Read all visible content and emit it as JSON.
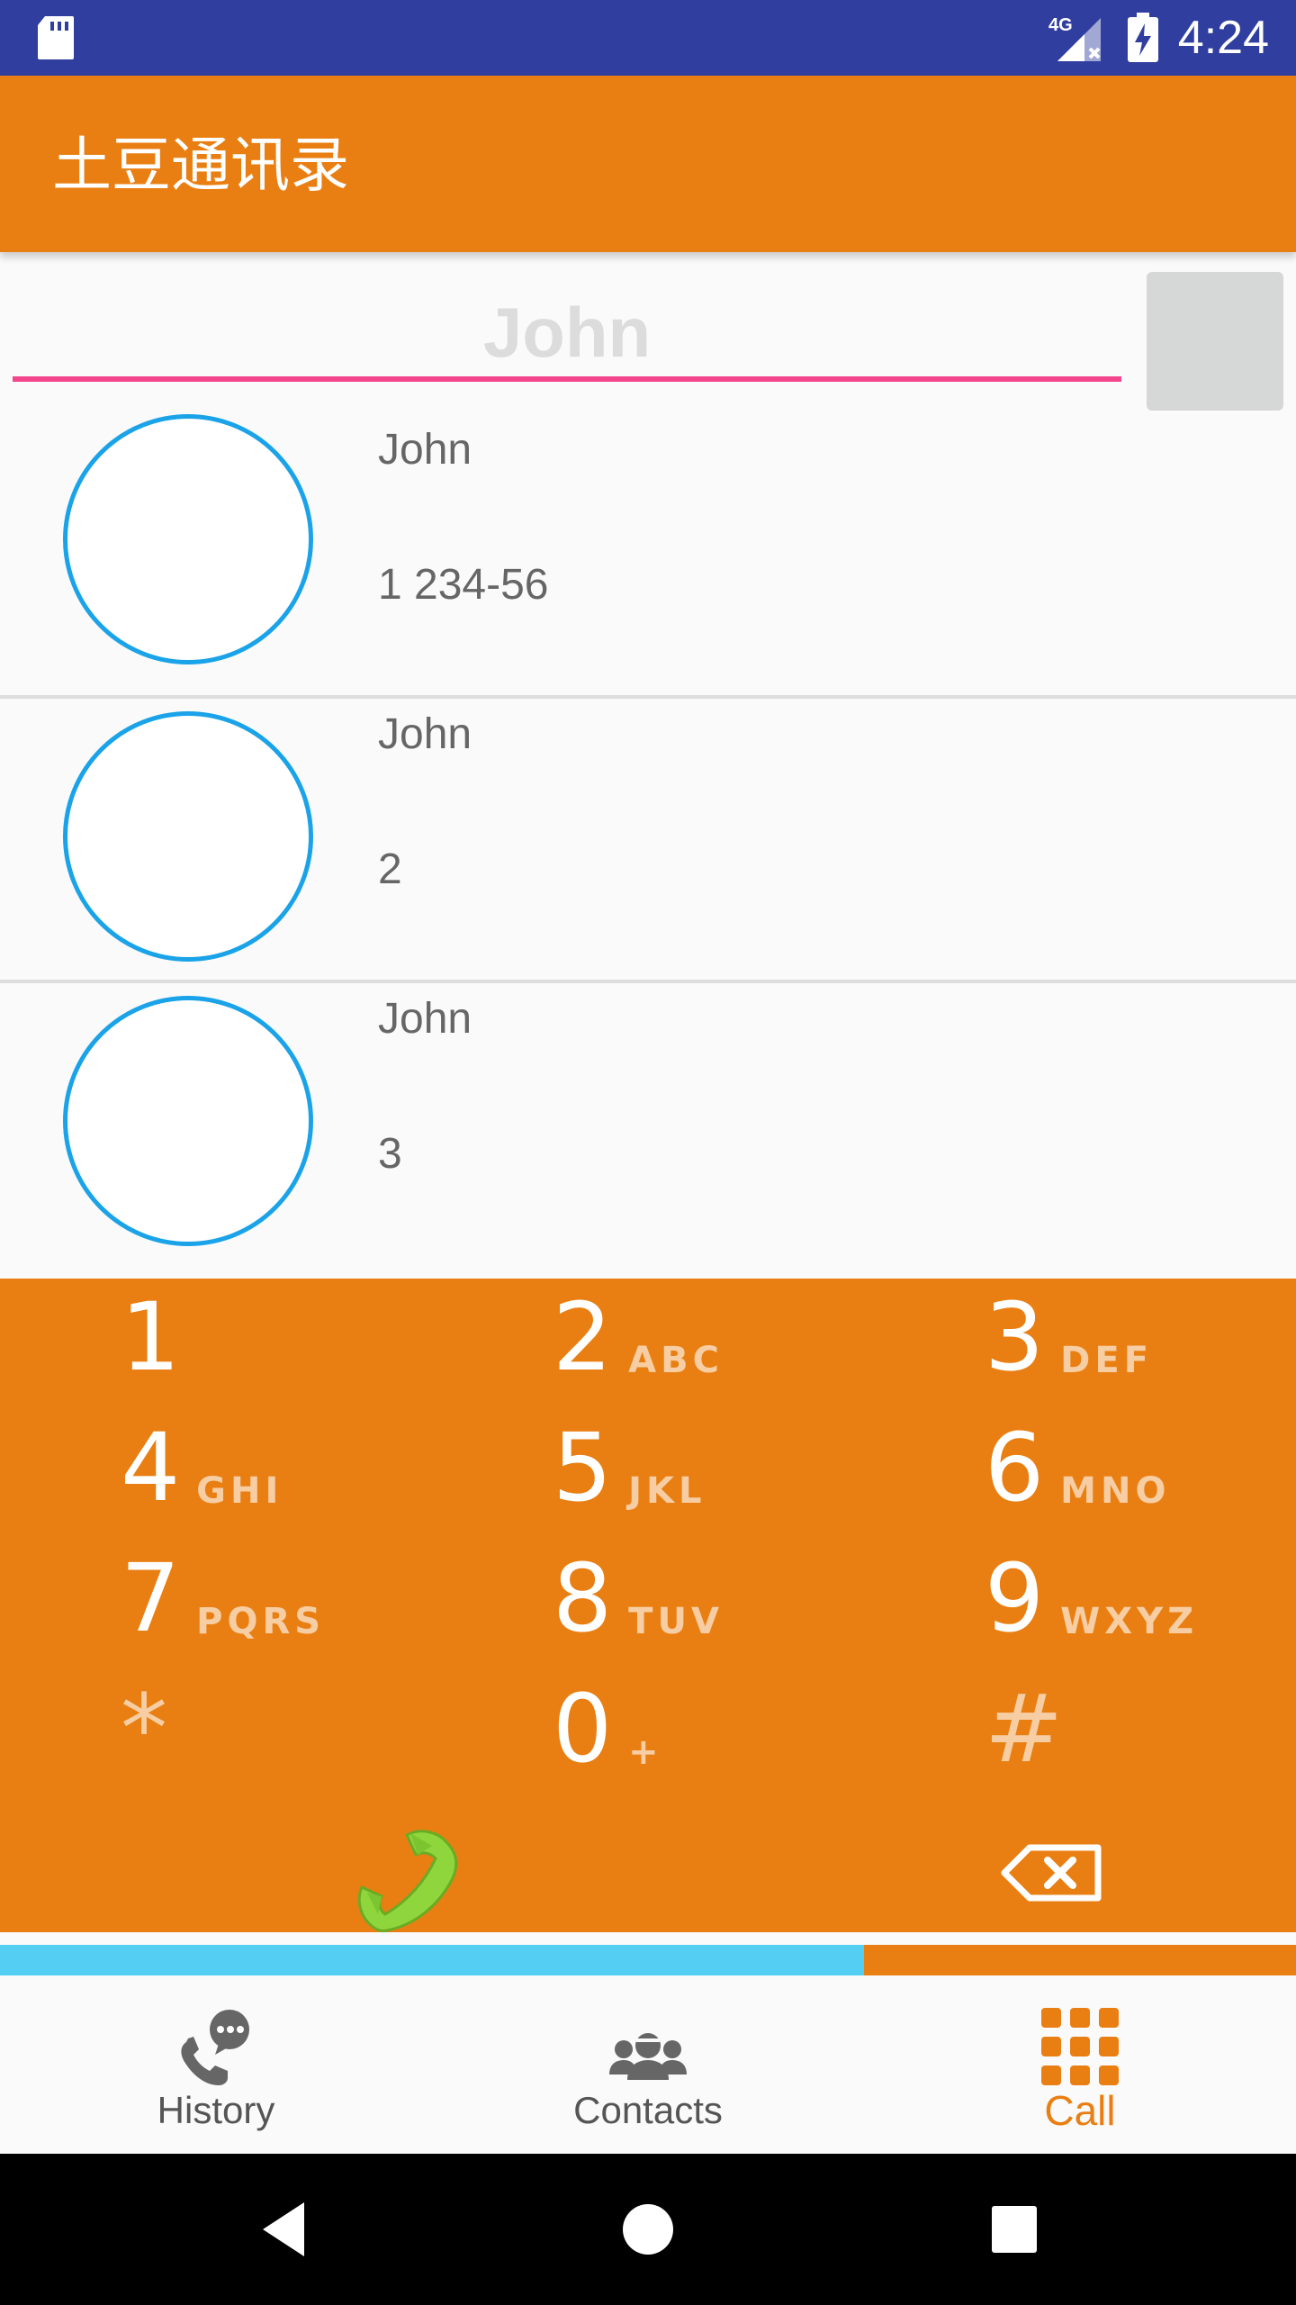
{
  "status_bar": {
    "time": "4:24",
    "network_label": "4G",
    "icons": [
      "sd-card-icon",
      "signal-icon",
      "battery-charging-icon"
    ]
  },
  "app_bar": {
    "title": "土豆通讯录"
  },
  "search": {
    "placeholder": "John",
    "value": ""
  },
  "contacts": [
    {
      "name": "John",
      "number": "1 234-56"
    },
    {
      "name": "John",
      "number": "2"
    },
    {
      "name": "John",
      "number": "3"
    }
  ],
  "dialpad": {
    "keys": [
      {
        "digit": "1",
        "letters": ""
      },
      {
        "digit": "2",
        "letters": "ABC"
      },
      {
        "digit": "3",
        "letters": "DEF"
      },
      {
        "digit": "4",
        "letters": "GHI"
      },
      {
        "digit": "5",
        "letters": "JKL"
      },
      {
        "digit": "6",
        "letters": "MNO"
      },
      {
        "digit": "7",
        "letters": "PQRS"
      },
      {
        "digit": "8",
        "letters": "TUV"
      },
      {
        "digit": "9",
        "letters": "WXYZ"
      },
      {
        "digit": "*",
        "letters": ""
      },
      {
        "digit": "0",
        "letters": "+"
      },
      {
        "digit": "#",
        "letters": ""
      }
    ],
    "icons": [
      "phone-call-icon",
      "backspace-icon"
    ]
  },
  "tab_indicator": {
    "progress": 0.667
  },
  "bottom_nav": {
    "tabs": [
      {
        "label": "History",
        "icon": "call-history-icon",
        "active": false
      },
      {
        "label": "Contacts",
        "icon": "contacts-icon",
        "active": false
      },
      {
        "label": "Call",
        "icon": "dialpad-icon",
        "active": true
      }
    ]
  },
  "system_nav": {
    "icons": [
      "back-icon",
      "home-icon",
      "recents-icon"
    ]
  },
  "colors": {
    "status_bar": "#303f9f",
    "accent_orange": "#e97f12",
    "search_underline": "#f2458b",
    "avatar_border": "#1aa3e8",
    "indicator_blue": "#55cef4",
    "call_green": "#8fd63c"
  }
}
